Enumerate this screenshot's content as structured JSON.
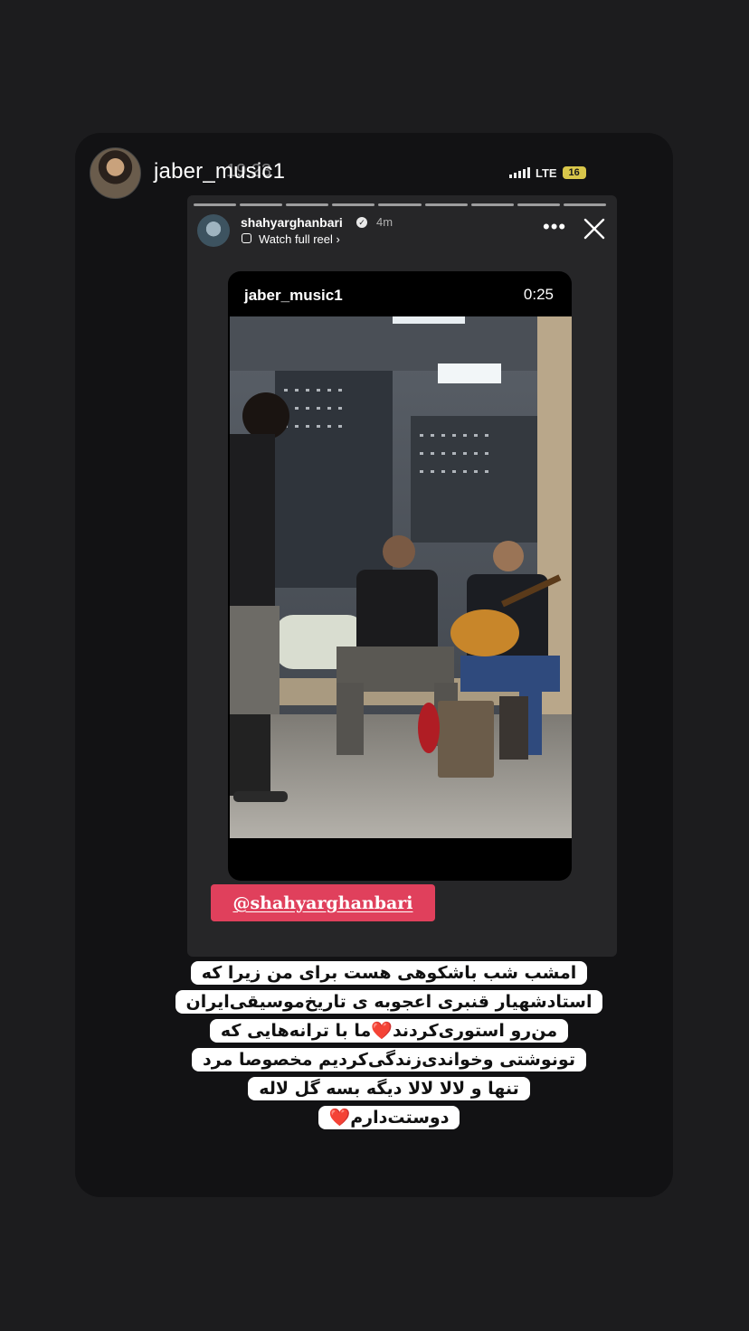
{
  "status_bar": {
    "time": "19:23",
    "network": "LTE",
    "battery": "16"
  },
  "story": {
    "username": "jaber_music1"
  },
  "reshared_post": {
    "username": "shahyarghanbari",
    "time_ago": "4m",
    "watch_full_reel": "Watch full reel ›",
    "more_icon": "more-horizontal-icon",
    "close_icon": "close-icon",
    "video": {
      "username": "jaber_music1",
      "duration": "0:25"
    }
  },
  "mention_sticker": "@shahyarghanbari",
  "caption": {
    "lines": [
      "امشب شب باشکوهی هست برای من زیرا که",
      "استادشهیار قنبری اعجوبه ی تاریخ‌موسیقی‌ایران",
      "من‌رو استوری‌کردند",
      "ما با ترانه‌هایی که",
      "تونوشتی وخواندی‌زندگی‌کردیم مخصوصا مرد",
      "تنها و لالا لالا دیگه بسه گل لاله",
      "دوستت‌دارم"
    ],
    "heart": "❤️"
  },
  "colors": {
    "background": "#1c1c1e",
    "card": "#121214",
    "reshare_panel": "#262628",
    "mention": "#e0405c",
    "heart": "#e0243c"
  }
}
